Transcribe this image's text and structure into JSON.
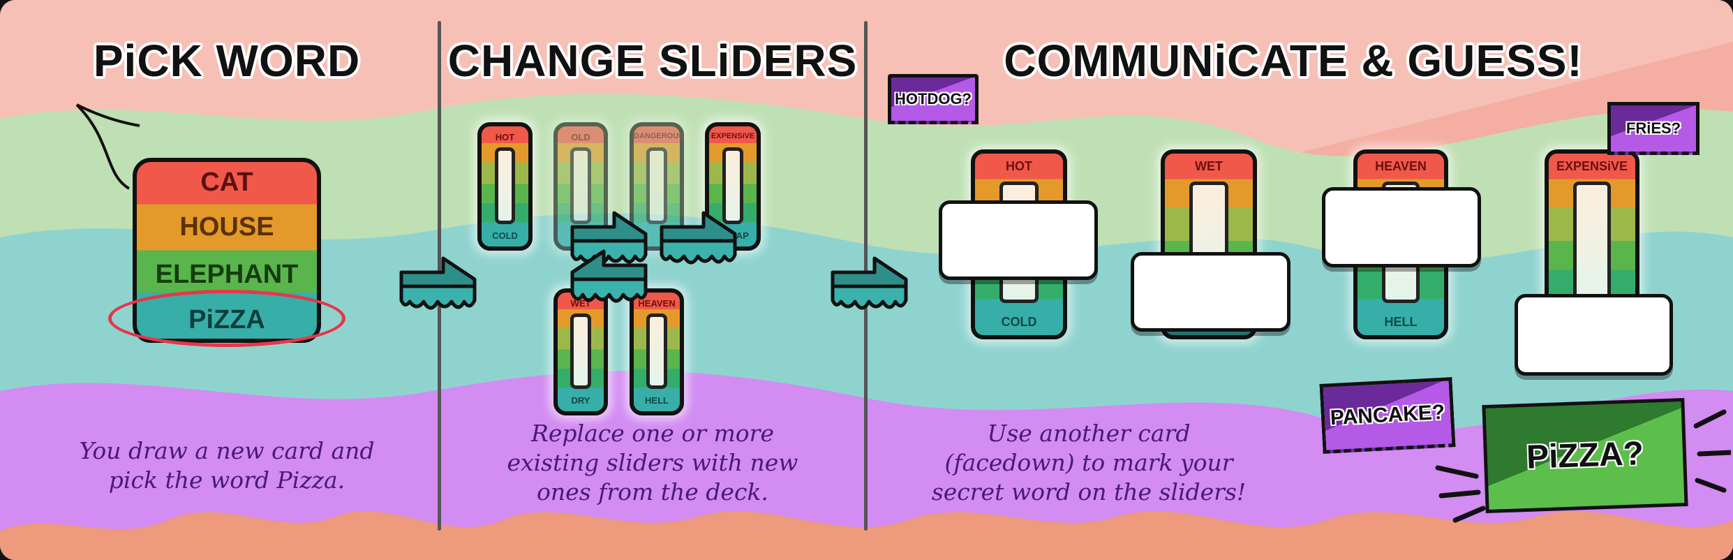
{
  "panels": [
    {
      "title": "PiCK WORD",
      "caption": [
        "You draw a new card and",
        "pick the word Pizza."
      ]
    },
    {
      "title": "CHANGE SLiDERS",
      "caption": [
        "Replace one or more",
        "existing sliders with new",
        "ones from the deck."
      ]
    },
    {
      "title": "COMMUNiCATE & GUESS!",
      "caption": [
        "Use another card",
        "(facedown) to mark your",
        "secret word on the sliders!"
      ]
    }
  ],
  "word_card": {
    "words": [
      "CAT",
      "HOUSE",
      "ELEPHANT",
      "PiZZA"
    ],
    "selected": "PiZZA"
  },
  "change_sliders": {
    "top_row": [
      {
        "top": "HOT",
        "bottom": "COLD"
      },
      {
        "top": "OLD",
        "bottom": ""
      },
      {
        "top": "DANGEROUS",
        "bottom": ""
      },
      {
        "top": "EXPENSiVE",
        "bottom": "CHEAP"
      }
    ],
    "new_row": [
      {
        "top": "WET",
        "bottom": "DRY"
      },
      {
        "top": "HEAVEN",
        "bottom": "HELL"
      }
    ]
  },
  "guess_sliders": [
    {
      "top": "HOT",
      "bottom": "COLD"
    },
    {
      "top": "WET",
      "bottom": ""
    },
    {
      "top": "HEAVEN",
      "bottom": "HELL"
    },
    {
      "top": "EXPENSiVE",
      "bottom": ""
    }
  ],
  "guesses": [
    "HOTDOG?",
    "FRiES?",
    "PANCAKE?",
    "PiZZA?"
  ],
  "colors": {
    "pink": "#f7c0b6",
    "green": "#bfe0b4",
    "teal": "#8fd3cf",
    "purple": "#d28cf2",
    "caption": "#4a1a70",
    "highlight": "#e8364a",
    "arrow": "#3bb3ac"
  }
}
